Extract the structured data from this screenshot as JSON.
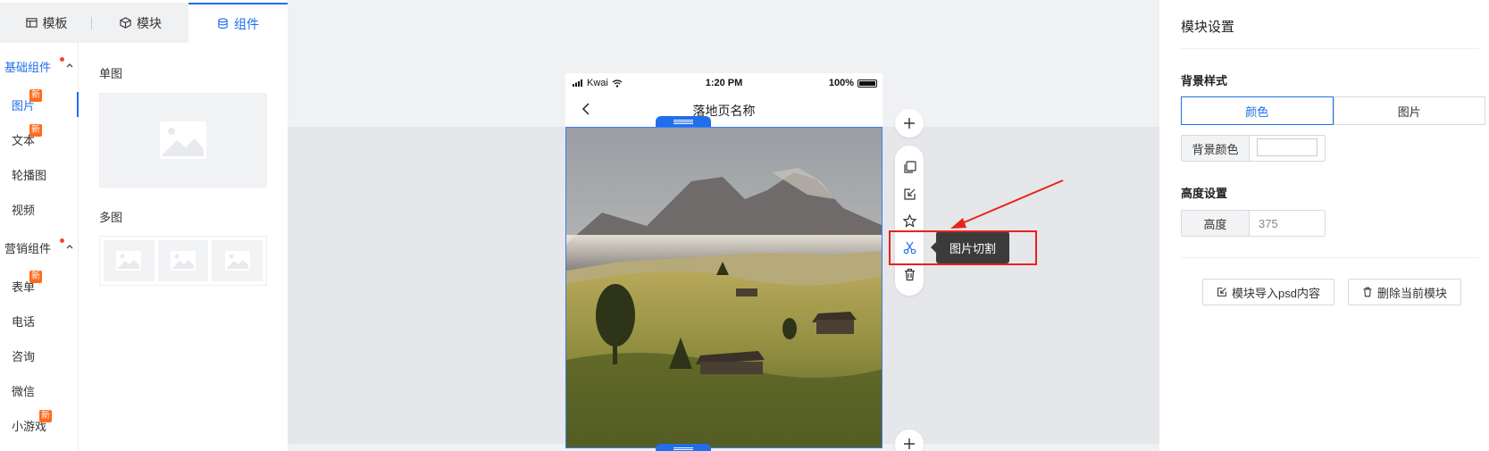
{
  "tabs": [
    {
      "label": "模板",
      "icon": "template-icon"
    },
    {
      "label": "模块",
      "icon": "cube-icon"
    },
    {
      "label": "组件",
      "icon": "database-icon"
    }
  ],
  "categories": {
    "basic": {
      "label": "基础组件"
    },
    "marketing": {
      "label": "营销组件"
    }
  },
  "new_badge": "新",
  "basic_items": [
    {
      "label": "图片",
      "is_new": true
    },
    {
      "label": "文本",
      "is_new": true
    },
    {
      "label": "轮播图",
      "is_new": false
    },
    {
      "label": "视频",
      "is_new": false
    }
  ],
  "marketing_items": [
    {
      "label": "表单",
      "is_new": true
    },
    {
      "label": "电话",
      "is_new": false
    },
    {
      "label": "咨询",
      "is_new": false
    },
    {
      "label": "微信",
      "is_new": false
    },
    {
      "label": "小游戏",
      "is_new": true
    }
  ],
  "components": {
    "single_title": "单图",
    "multi_title": "多图"
  },
  "phone": {
    "carrier": "Kwai",
    "time": "1:20 PM",
    "battery": "100%",
    "page_title": "落地页名称"
  },
  "toolbar": {
    "add_icon": "plus-icon",
    "tools": [
      "copy-icon",
      "import-icon",
      "star-icon",
      "scissors-icon",
      "trash-icon"
    ],
    "tooltip": "图片切割"
  },
  "settings": {
    "title": "模块设置",
    "bg_section": "背景样式",
    "bg_options": [
      "颜色",
      "图片"
    ],
    "bg_selected": "颜色",
    "bg_color_label": "背景颜色",
    "bg_color_value": "#ffffff",
    "height_section": "高度设置",
    "height_label": "高度",
    "height_value": "375",
    "import_button": "模块导入psd内容",
    "delete_button": "删除当前模块"
  },
  "colors": {
    "accent": "#1f6fea",
    "badge": "#ff6a1a",
    "annotation": "#e8231b"
  }
}
